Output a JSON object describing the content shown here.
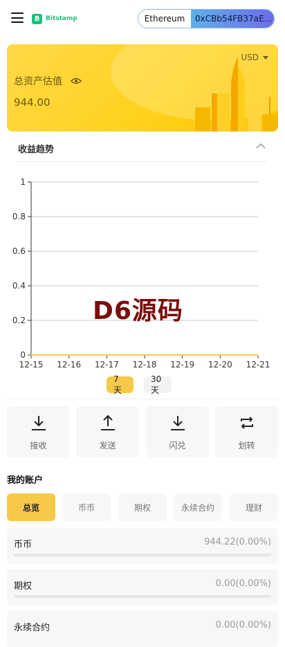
{
  "header": {
    "logo_text": "Bitstamp",
    "logo_mark": "B",
    "network": "Ethereum",
    "address": "0xCBb54FB37aE…"
  },
  "asset": {
    "label": "总资产估值",
    "value": "944.00",
    "currency": "USD"
  },
  "trend": {
    "title": "收益趋势"
  },
  "chart_data": {
    "type": "line",
    "x": [
      "12-15",
      "12-16",
      "12-17",
      "12-18",
      "12-19",
      "12-20",
      "12-21"
    ],
    "series": [
      {
        "values": [
          0,
          0,
          0,
          0,
          0,
          0,
          0
        ]
      }
    ],
    "y_ticks": [
      "0",
      "0.2",
      "0.4",
      "0.6",
      "0.8",
      "1"
    ],
    "ylim": [
      0,
      1
    ],
    "grid": true,
    "colors": {
      "line": "#f7c948",
      "grid": "#cccccc",
      "axis": "#333333"
    }
  },
  "watermark": "D6源码",
  "range_tabs": {
    "active": "7天",
    "inactive": "30天"
  },
  "actions": [
    {
      "label": "接收",
      "icon": "download-icon"
    },
    {
      "label": "发送",
      "icon": "upload-icon"
    },
    {
      "label": "闪兑",
      "icon": "swap-down-icon"
    },
    {
      "label": "划转",
      "icon": "transfer-icon"
    }
  ],
  "accounts": {
    "title": "我的账户",
    "tabs": [
      "总览",
      "币币",
      "期权",
      "永续合约",
      "理财"
    ],
    "rows": [
      {
        "name": "币币",
        "value": "944.22(0.00%)"
      },
      {
        "name": "期权",
        "value": "0.00(0.00%)"
      },
      {
        "name": "永续合约",
        "value": "0.00(0.00%)"
      }
    ]
  },
  "colors": {
    "accent": "#f7c948",
    "brand": "#19c37d"
  }
}
